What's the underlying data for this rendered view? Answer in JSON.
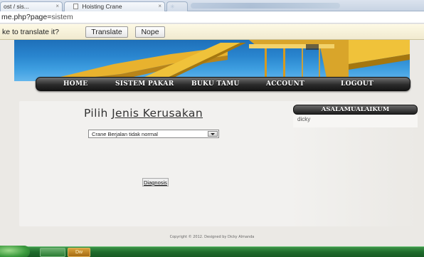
{
  "browser": {
    "tabs": [
      {
        "label": "ost / sis...",
        "close": "×"
      },
      {
        "label": "Hoisting Crane",
        "close": "×"
      },
      {
        "label": ""
      }
    ],
    "url_prefix": "me.php?page=",
    "url_rest": "sistem"
  },
  "translate_bar": {
    "question": "ke to translate it?",
    "translate_label": "Translate",
    "nope_label": "Nope"
  },
  "nav": {
    "items": [
      "HOME",
      "SISTEM PAKAR",
      "BUKU TAMU",
      "ACCOUNT",
      "LOGOUT"
    ]
  },
  "main": {
    "title_prefix": "Pilih ",
    "title_underlined": "Jenis Kerusakan",
    "select_value": "Crane Berjalan tidak normal",
    "diagnose_label": "Diagnosis"
  },
  "sidebar": {
    "header": "ASALAMUALAIKUM",
    "username": "dicky"
  },
  "footer": {
    "copyright": "Copyright © 2012. Designed by Dicky Almanda"
  },
  "taskbar": {
    "start": "",
    "apps": [
      "",
      "Dw"
    ]
  },
  "colors": {
    "banner_blue": "#2a86cf",
    "crane_yellow": "#e8b22e",
    "nav_dark": "#2b2b2b",
    "taskbar_green": "#1f6b2c"
  }
}
